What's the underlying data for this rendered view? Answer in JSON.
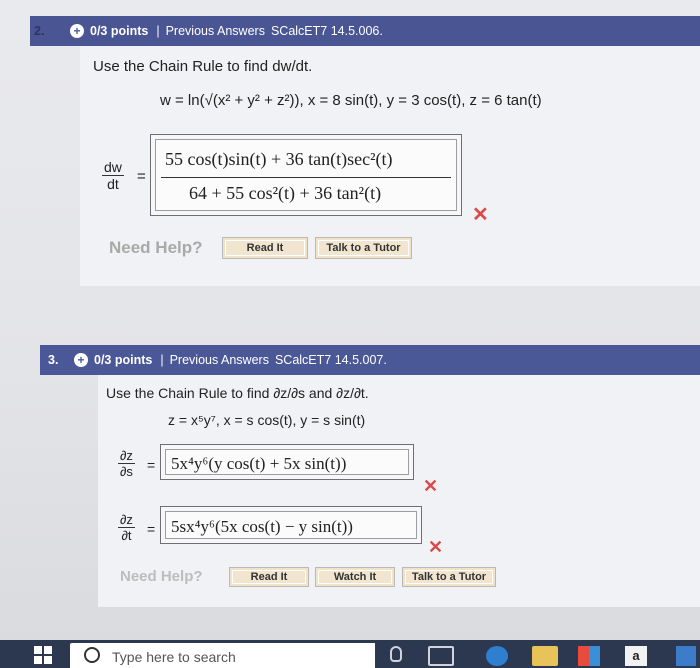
{
  "q2": {
    "number": "2.",
    "points": "0/3 points",
    "separator": "|",
    "previous_answers": "Previous Answers",
    "code": "SCalcET7 14.5.006.",
    "prompt": "Use the Chain Rule to find dw/dt.",
    "equation": "w = ln(√(x² + y² + z²)),   x = 8 sin(t),   y = 3 cos(t),   z = 6 tan(t)",
    "lhs_num": "dw",
    "lhs_den": "dt",
    "eq_sign": "=",
    "answer_num": "55 cos(t)sin(t) + 36 tan(t)sec²(t)",
    "answer_den": "64 + 55 cos²(t) + 36 tan²(t)",
    "wrong_mark": "✕",
    "need_help": "Need Help?",
    "read_it": "Read It",
    "talk_tutor": "Talk to a Tutor"
  },
  "q3": {
    "number": "3.",
    "points": "0/3 points",
    "separator": "|",
    "previous_answers": "Previous Answers",
    "code": "SCalcET7 14.5.007.",
    "prompt": "Use the Chain Rule to find ∂z/∂s and ∂z/∂t.",
    "equation": "z = x⁵y⁷,   x = s cos(t),   y = s sin(t)",
    "dzds_num": "∂z",
    "dzds_den": "∂s",
    "dzds_answer": "5x⁴y⁶(y cos(t) + 5x sin(t))",
    "dzdt_num": "∂z",
    "dzdt_den": "∂t",
    "dzdt_answer": "5sx⁴y⁶(5x cos(t) − y sin(t))",
    "eq_sign": "=",
    "wrong_mark": "✕",
    "need_help": "Need Help?",
    "read_it": "Read It",
    "watch_it": "Watch It",
    "talk_tutor": "Talk to a Tutor"
  },
  "taskbar": {
    "search_placeholder": "Type here to search",
    "store_letter": "a"
  },
  "colors": {
    "header_bar": "#4b5898",
    "wrong": "#d94a48",
    "need_help": "#b6b6b6",
    "help_button": "#f3e3c6"
  }
}
